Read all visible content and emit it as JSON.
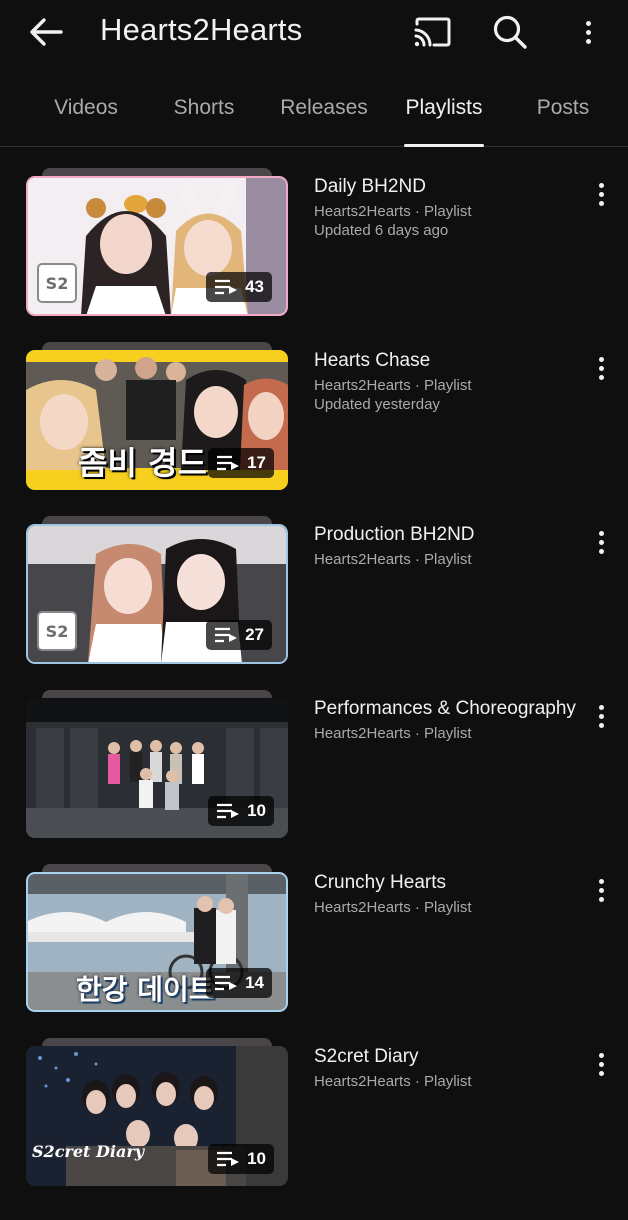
{
  "header": {
    "title": "Hearts2Hearts",
    "back_icon": "arrow-left-icon",
    "cast_icon": "cast-icon",
    "search_icon": "search-icon",
    "more_icon": "more-vert-icon"
  },
  "tabs": [
    {
      "label": "Videos",
      "active": false
    },
    {
      "label": "Shorts",
      "active": false
    },
    {
      "label": "Releases",
      "active": false
    },
    {
      "label": "Playlists",
      "active": true
    },
    {
      "label": "Posts",
      "active": false
    }
  ],
  "playlists": [
    {
      "title": "Daily BH2ND",
      "channel_meta": "Hearts2Hearts · Playlist",
      "updated": "Updated 6 days ago",
      "count": "43"
    },
    {
      "title": "Hearts Chase",
      "channel_meta": "Hearts2Hearts · Playlist",
      "updated": "Updated yesterday",
      "count": "17",
      "thumb_text": "좀비 경드"
    },
    {
      "title": "Production BH2ND",
      "channel_meta": "Hearts2Hearts · Playlist",
      "count": "27"
    },
    {
      "title": "Performances & Choreography",
      "channel_meta": "Hearts2Hearts · Playlist",
      "count": "10"
    },
    {
      "title": "Crunchy Hearts",
      "channel_meta": "Hearts2Hearts · Playlist",
      "count": "14",
      "thumb_text": "한강 데이트"
    },
    {
      "title": "S2cret Diary",
      "channel_meta": "Hearts2Hearts · Playlist",
      "count": "10",
      "thumb_text": "S2cret Diary"
    }
  ],
  "colors": {
    "background": "#0f0f0f",
    "text_primary": "#f1f1f1",
    "text_secondary": "#aaaaaa",
    "divider": "#303030"
  }
}
